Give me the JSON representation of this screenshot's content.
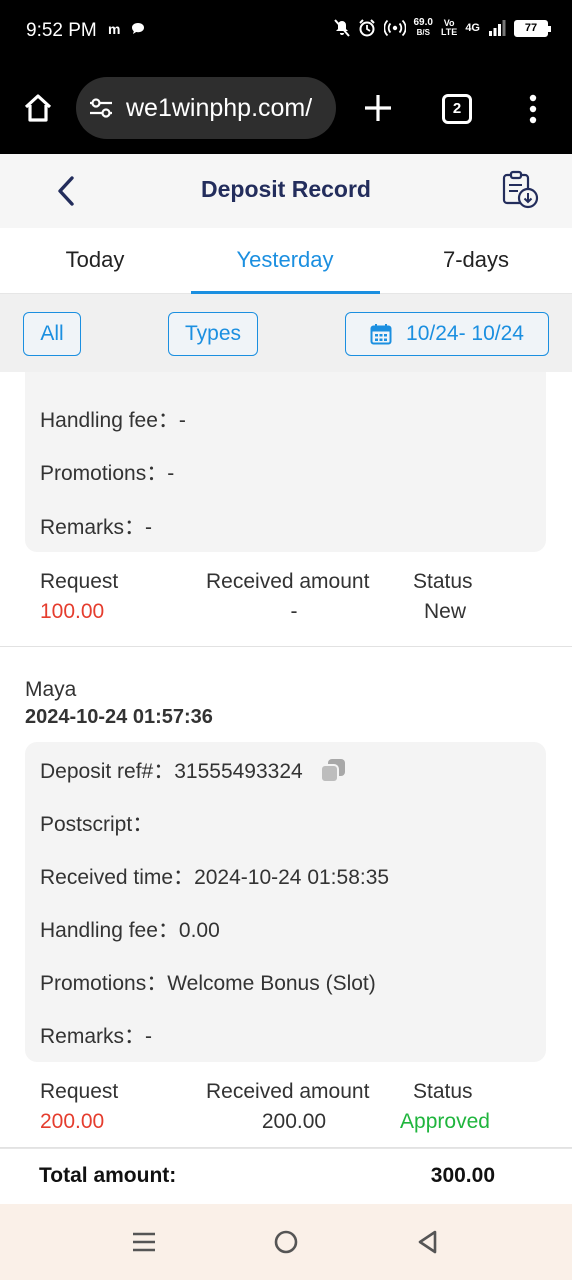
{
  "status_bar": {
    "time": "9:52 PM",
    "notification_icons": [
      "m",
      "chat-bubble-icon"
    ],
    "net_speed_value": "69.0",
    "net_speed_unit": "B/S",
    "volte_top": "Vo",
    "volte_bottom": "LTE",
    "network": "4G",
    "battery": "77"
  },
  "browser": {
    "url": "we1winphp.com/",
    "tab_count": "2"
  },
  "header": {
    "title": "Deposit Record"
  },
  "tabs": [
    {
      "label": "Today",
      "active": false
    },
    {
      "label": "Yesterday",
      "active": true
    },
    {
      "label": "7-days",
      "active": false
    }
  ],
  "filters": {
    "all_label": "All",
    "types_label": "Types",
    "date_range": "10/24- 10/24"
  },
  "records": [
    {
      "details": [
        {
          "label": "Handling fee：",
          "value": "-"
        },
        {
          "label": "Promotions：",
          "value": "-"
        },
        {
          "label": "Remarks：",
          "value": "-"
        }
      ],
      "request_label": "Request",
      "request_value": "100.00",
      "received_label": "Received amount",
      "received_value": "-",
      "status_label": "Status",
      "status_value": "New"
    },
    {
      "method": "Maya",
      "datetime": "2024-10-24 01:57:36",
      "details": [
        {
          "label": "Deposit ref#：",
          "value": "31555493324"
        },
        {
          "label": "Postscript：",
          "value": ""
        },
        {
          "label": "Received time：",
          "value": "2024-10-24 01:58:35"
        },
        {
          "label": "Handling fee：",
          "value": "0.00"
        },
        {
          "label": "Promotions：",
          "value": "Welcome Bonus (Slot)"
        },
        {
          "label": "Remarks：",
          "value": "-"
        }
      ],
      "request_label": "Request",
      "request_value": "200.00",
      "received_label": "Received amount",
      "received_value": "200.00",
      "status_label": "Status",
      "status_value": "Approved"
    }
  ],
  "total": {
    "label": "Total amount:",
    "value": "300.00"
  },
  "colors": {
    "accent": "#1b8fe0",
    "title": "#232d5c",
    "request": "#e53d2e",
    "approved": "#1fb53d"
  },
  "icons": {
    "home": "home-icon",
    "site_settings": "tune-icon",
    "new_tab": "plus-icon",
    "tabs": "tabs-icon",
    "menu": "more-vert-icon",
    "back": "back-icon",
    "download_record": "clipboard-download-icon",
    "calendar": "calendar-icon",
    "copy": "copy-icon"
  }
}
